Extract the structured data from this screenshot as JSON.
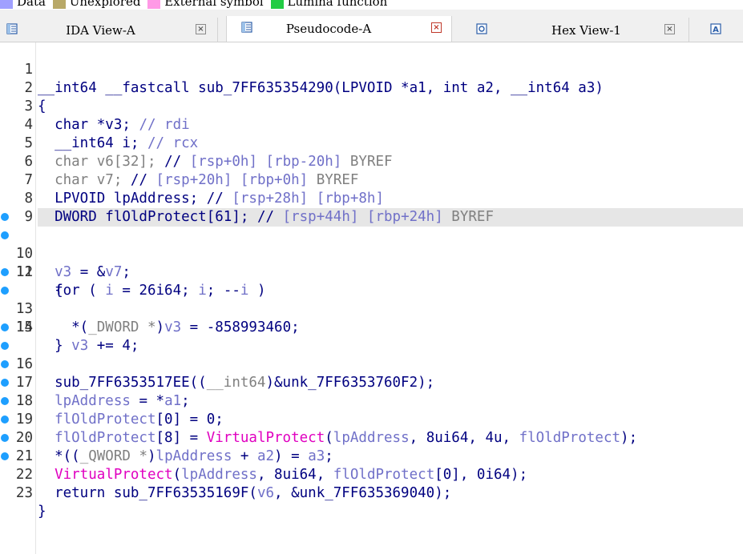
{
  "legend": [
    {
      "label": "Data",
      "color": "#a0a0ff"
    },
    {
      "label": "Unexplored",
      "color": "#b8a868"
    },
    {
      "label": "External symbol",
      "color": "#ff99e6"
    },
    {
      "label": "Lumina function",
      "color": "#22cc44"
    }
  ],
  "tabs": [
    {
      "label": "IDA View-A",
      "icon": "ida-view-icon",
      "active": false
    },
    {
      "label": "Pseudocode-A",
      "icon": "pseudocode-icon",
      "active": true
    },
    {
      "label": "Hex View-1",
      "icon": "hex-view-icon",
      "active": false
    },
    {
      "label": "",
      "icon": "structures-icon",
      "active": false
    }
  ],
  "code_lines": [
    {
      "n": "1",
      "bp": false,
      "hl": false,
      "html": "__int64 __fastcall sub_7FF635354290(LPVOID *a1, int a2, __int64 a3)"
    },
    {
      "n": "2",
      "bp": false,
      "hl": false,
      "html": "{"
    },
    {
      "n": "3",
      "bp": false,
      "hl": false,
      "html": "  char *v3; // rdi"
    },
    {
      "n": "4",
      "bp": false,
      "hl": false,
      "html": "  __int64 i; // rcx"
    },
    {
      "n": "5",
      "bp": false,
      "hl": false,
      "html": "  char v6[32]; // [rsp+0h] [rbp-20h] BYREF"
    },
    {
      "n": "6",
      "bp": false,
      "hl": false,
      "html": "  char v7; // [rsp+20h] [rbp+0h] BYREF"
    },
    {
      "n": "7",
      "bp": false,
      "hl": false,
      "html": "  LPVOID lpAddress; // [rsp+28h] [rbp+8h]"
    },
    {
      "n": "8",
      "bp": false,
      "hl": true,
      "html": "  DWORD flOldProtect[61]; // [rsp+44h] [rbp+24h] BYREF"
    },
    {
      "n": "9",
      "bp": false,
      "hl": false,
      "html": ""
    },
    {
      "n": "10",
      "bp": true,
      "hl": false,
      "html": "  v3 = &v7;"
    },
    {
      "n": "11",
      "bp": true,
      "hl": false,
      "html": "  for ( i = 26i64; i; --i )"
    },
    {
      "n": "12",
      "bp": false,
      "hl": false,
      "html": "  {"
    },
    {
      "n": "13",
      "bp": true,
      "hl": false,
      "html": "    *(_DWORD *)v3 = -858993460;"
    },
    {
      "n": "14",
      "bp": true,
      "hl": false,
      "html": "    v3 += 4;"
    },
    {
      "n": "15",
      "bp": false,
      "hl": false,
      "html": "  }"
    },
    {
      "n": "16",
      "bp": true,
      "hl": false,
      "html": "  sub_7FF6353517EE((__int64)&unk_7FF6353760F2);"
    },
    {
      "n": "17",
      "bp": true,
      "hl": false,
      "html": "  lpAddress = *a1;"
    },
    {
      "n": "18",
      "bp": true,
      "hl": false,
      "html": "  flOldProtect[0] = 0;"
    },
    {
      "n": "19",
      "bp": true,
      "hl": false,
      "html": "  flOldProtect[8] = VirtualProtect(lpAddress, 8ui64, 4u, flOldProtect);"
    },
    {
      "n": "20",
      "bp": true,
      "hl": false,
      "html": "  *((_QWORD *)lpAddress + a2) = a3;"
    },
    {
      "n": "21",
      "bp": true,
      "hl": false,
      "html": "  VirtualProtect(lpAddress, 8ui64, flOldProtect[0], 0i64);"
    },
    {
      "n": "22",
      "bp": true,
      "hl": false,
      "html": "  return sub_7FF63535169F(v6, &unk_7FF635369040);"
    },
    {
      "n": "23",
      "bp": true,
      "hl": false,
      "html": "}"
    }
  ],
  "colors": {
    "breakpoint": "#1e9fff",
    "keyword": "#000080",
    "variable": "#7070c8",
    "api_call": "#e000c0",
    "highlight": "#e6e6e6"
  }
}
